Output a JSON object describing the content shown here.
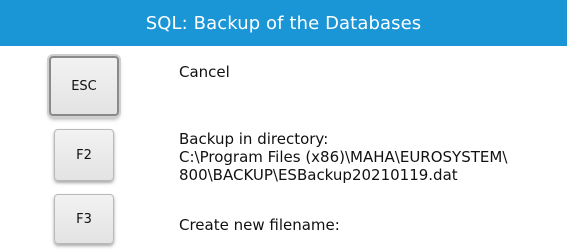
{
  "header": {
    "title": "SQL: Backup of the Databases"
  },
  "actions": [
    {
      "key": "ESC",
      "lines": [
        "Cancel"
      ]
    },
    {
      "key": "F2",
      "lines": [
        "Backup in directory:",
        "C:\\Program Files (x86)\\MAHA\\EUROSYSTEM\\",
        "800\\BACKUP\\ESBackup20210119.dat"
      ]
    },
    {
      "key": "F3",
      "lines": [
        "Create new filename:"
      ]
    }
  ]
}
